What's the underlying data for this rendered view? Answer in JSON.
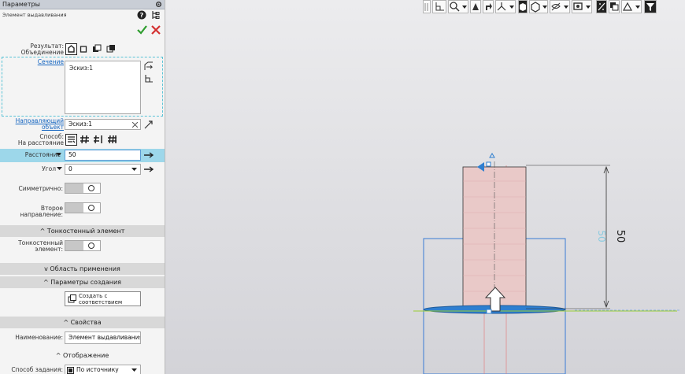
{
  "panel": {
    "title": "Параметры",
    "operation": "Элемент выдавливания",
    "result_label": "Результат:",
    "result_value": "Объединение",
    "section_link": "Сечение",
    "section_item": "Эскиз:1",
    "guide_link_1": "Направляющий",
    "guide_link_2": "объект",
    "guide_value": "Эскиз:1",
    "method_label": "Способ:",
    "method_value": "На расстояние",
    "distance_label": "Расстояние",
    "distance_value": "50",
    "angle_label": "Угол",
    "angle_value": "0",
    "symmetric_label": "Симметрично:",
    "second_direction_label": "Второе направление:",
    "thin_wall_section": "Тонкостенный элемент",
    "thin_wall_label_1": "Тонкостенный",
    "thin_wall_label_2": "элемент:",
    "scope_section": "Область применения",
    "creation_section": "Параметры создания",
    "create_button_1": "Создать с",
    "create_button_2": "соответствием",
    "properties_section": "Свойства",
    "name_label": "Наименование:",
    "name_value": "Элемент выдавливания:",
    "display_section": "Отображение",
    "mode_label": "Способ задания:",
    "mode_value": "По источнику"
  },
  "viewport": {
    "dimension_value": "50",
    "dimension_ghost": "50",
    "colors": {
      "body_fill": "#e9c9c8",
      "frame": "#3a7bd5",
      "base_disc": "#2f7fd0",
      "axis_green": "#9acd32"
    }
  }
}
